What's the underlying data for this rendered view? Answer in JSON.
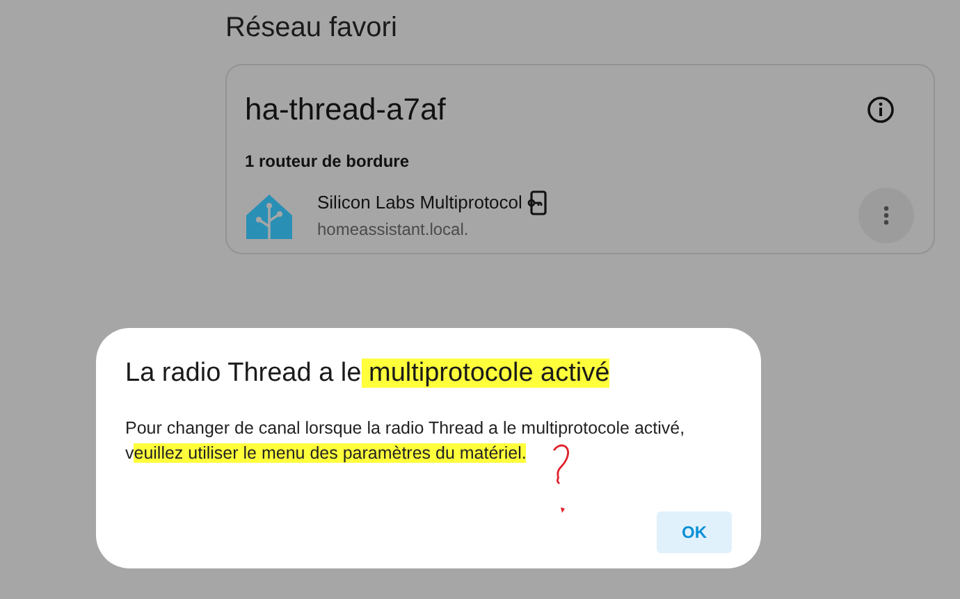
{
  "section_title": "Réseau favori",
  "network_card": {
    "title": "ha-thread-a7af",
    "routers_label": "1 routeur de bordure",
    "router": {
      "name": "Silicon Labs Multiprotocol",
      "host": "homeassistant.local."
    }
  },
  "dialog": {
    "title": [
      {
        "text": "La radio Thread a le",
        "highlighted": false
      },
      {
        "text": " multiprotocole activé",
        "highlighted": true
      }
    ],
    "body": [
      {
        "text": "Pour changer de canal lorsque la radio Thread a le multiprotocole activé, v",
        "highlighted": false
      },
      {
        "text": "euillez utiliser le menu des paramètres du matériel.",
        "highlighted": true
      }
    ],
    "button": "OK"
  }
}
